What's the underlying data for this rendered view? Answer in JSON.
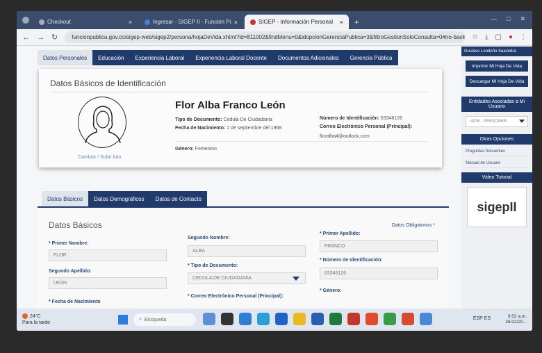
{
  "browser": {
    "tabs": [
      {
        "label": "Checkout",
        "active": false
      },
      {
        "label": "Ingresar - SIGEP II - Función Pública",
        "active": false
      },
      {
        "label": "SIGEP - Información Personal",
        "active": true
      }
    ],
    "new_tab": "+",
    "url": "funcionpublica.gov.co/sigep-web/sigep2/persona/hojaDeVida.xhtml?id=811002&findMenu=0&idopcionGerenciaPublica=3&filtroGestionSoloConsulta=0#no-back-..."
  },
  "section_nav": {
    "items": [
      "Datos Personales",
      "Educación",
      "Experiencia Laboral",
      "Experiencia Laboral Docente",
      "Documentos Adicionales",
      "Gerencia Pública"
    ]
  },
  "identification": {
    "title": "Datos Básicos de Identificación",
    "full_name": "Flor Alba Franco León",
    "change_photo": "Cambiar / Subir foto",
    "tipo_doc_label": "Tipo de Documento:",
    "tipo_doc_value": "Cedula De Ciudadania",
    "fecha_nac_label": "Fecha de Nacimiento:",
    "fecha_nac_value": "1 de septiembre del 1968",
    "genero_label": "Género:",
    "genero_value": "Femenino",
    "num_id_label": "Número de Identificación:",
    "num_id_value": "63346126",
    "correo_label": "Correo Electrónico Personal (Principal):",
    "correo_value": "floralba4@outlook.com"
  },
  "subtabs": [
    "Datos Básicos",
    "Datos Demográficos",
    "Datos de Contacto"
  ],
  "form": {
    "title": "Datos Básicos",
    "obligatorios": "Datos Obligatorios *",
    "primer_nombre_label": "* Primer Nombre:",
    "primer_nombre_value": "FLOR",
    "segundo_nombre_label": "Segundo Nombre:",
    "segundo_nombre_value": "ALBA",
    "primer_apellido_label": "* Primer Apellido:",
    "primer_apellido_value": "FRANCO",
    "segundo_apellido_label": "Segundo Apellido:",
    "segundo_apellido_value": "LEÓN",
    "tipo_documento_label": "* Tipo de Documento:",
    "tipo_documento_value": "CEDULA DE CIUDADANIA",
    "numero_id_label": "* Número de Identificación:",
    "numero_id_value": "63346126",
    "fecha_nacimiento_label": "* Fecha de Nacimiento",
    "correo_label": "* Correo Electrónico Personal (Principal):",
    "genero_label": "* Género:"
  },
  "sidebar": {
    "user_name": "Gustavo Londoño Saavedra",
    "imprimir": "Imprimir Mi Hoja De Vida",
    "descargar": "Descargar Mi Hoja De Vida",
    "entidades_title": "Entidades Asociadas a Mi Usuario",
    "entidad_value": "4976 - PERSONER",
    "otras_title": "Otras Opciones",
    "preguntas": "Preguntas frecuentes",
    "manual": "Manual de Usuario",
    "video_title": "Video Tutorial",
    "logo_text": "sigepII"
  },
  "taskbar": {
    "temp": "24°C",
    "weather_text": "Para la tarde",
    "search_placeholder": "Búsqueda",
    "lang": "ESP ES",
    "time": "9:52 a.m.",
    "date": "26/12/20..."
  },
  "colors": {
    "nav_blue": "#1f3a6b",
    "tabstrip": "#3c4c6c"
  }
}
